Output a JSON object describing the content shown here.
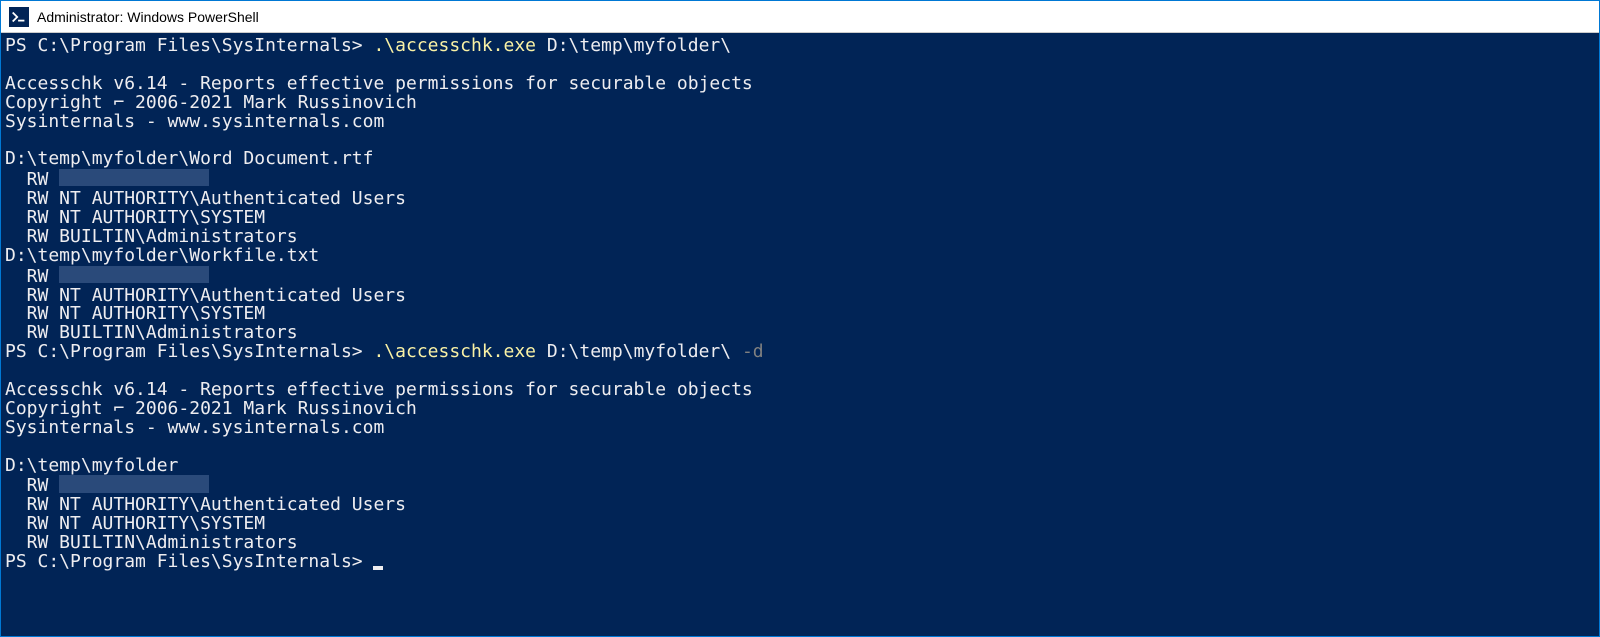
{
  "window": {
    "title": "Administrator: Windows PowerShell"
  },
  "prompts": {
    "path": "PS C:\\Program Files\\SysInternals> ",
    "cmd1_exec": ".\\accesschk.exe",
    "cmd1_args": " D:\\temp\\myfolder\\",
    "cmd2_exec": ".\\accesschk.exe",
    "cmd2_args": " D:\\temp\\myfolder\\ ",
    "cmd2_flag": "-d"
  },
  "banner": {
    "line1": "Accesschk v6.14 - Reports effective permissions for securable objects",
    "line2": "Copyright ⌐ 2006-2021 Mark Russinovich",
    "line3": "Sysinternals - www.sysinternals.com"
  },
  "out1": {
    "file1": "D:\\temp\\myfolder\\Word Document.rtf",
    "perm_rw": "  RW ",
    "auth": "  RW NT AUTHORITY\\Authenticated Users",
    "system": "  RW NT AUTHORITY\\SYSTEM",
    "admins": "  RW BUILTIN\\Administrators",
    "file2": "D:\\temp\\myfolder\\Workfile.txt"
  },
  "out2": {
    "folder": "D:\\temp\\myfolder",
    "perm_rw": "  RW ",
    "auth": "  RW NT AUTHORITY\\Authenticated Users",
    "system": "  RW NT AUTHORITY\\SYSTEM",
    "admins": "  RW BUILTIN\\Administrators"
  }
}
